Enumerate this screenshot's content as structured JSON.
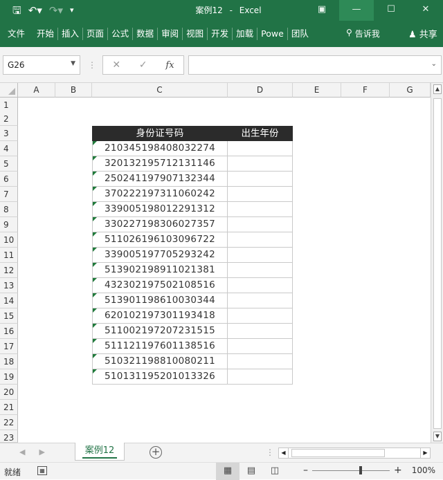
{
  "window": {
    "title": "案例12",
    "app": "Excel",
    "separator": "-"
  },
  "ribbon": {
    "tabs": [
      "文件",
      "开始",
      "插入",
      "页面",
      "公式",
      "数据",
      "审阅",
      "视图",
      "开发",
      "加载",
      "Powe",
      "团队"
    ],
    "tell_me": "告诉我",
    "share": "共享"
  },
  "formula_bar": {
    "name_box": "G26",
    "formula": ""
  },
  "columns": [
    "A",
    "B",
    "C",
    "D",
    "E",
    "F",
    "G"
  ],
  "rows": [
    "1",
    "2",
    "3",
    "4",
    "5",
    "6",
    "7",
    "8",
    "9",
    "10",
    "11",
    "12",
    "13",
    "14",
    "15",
    "16",
    "17",
    "18",
    "19",
    "20",
    "21",
    "22",
    "23"
  ],
  "table": {
    "headers": [
      "身份证号码",
      "出生年份"
    ],
    "ids": [
      "210345198408032274",
      "320132195712131146",
      "250241197907132344",
      "370222197311060242",
      "339005198012291312",
      "330227198306027357",
      "511026196103096722",
      "339005197705293242",
      "513902198911021381",
      "432302197502108516",
      "513901198610030344",
      "620102197301193418",
      "511002197207231515",
      "511121197601138516",
      "510321198810080211",
      "510131195201013326"
    ]
  },
  "sheets": {
    "active": "案例12"
  },
  "status": {
    "ready": "就绪",
    "zoom": "100%"
  }
}
